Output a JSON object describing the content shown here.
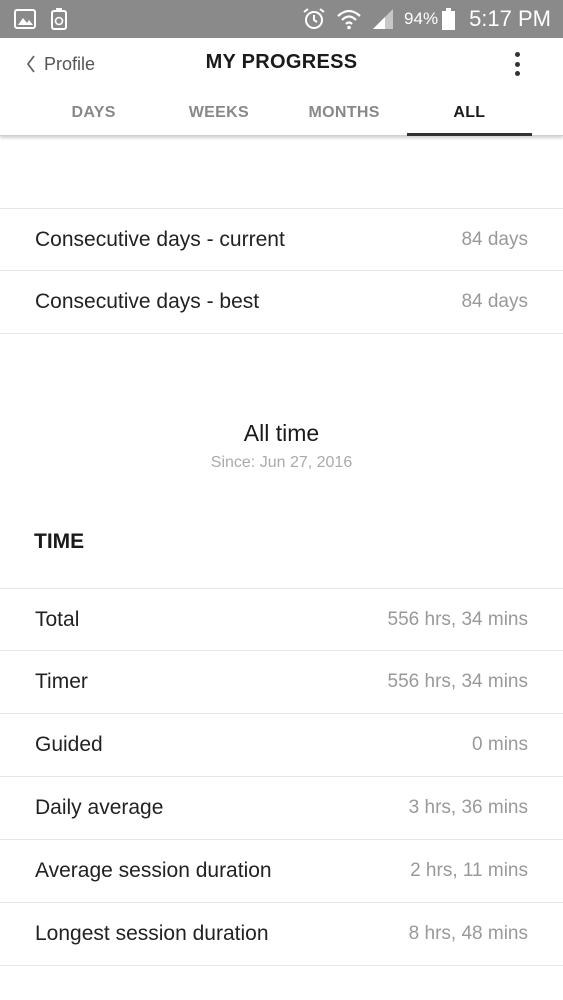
{
  "status_bar": {
    "battery_percent": "94%",
    "time": "5:17 PM",
    "icons": [
      "image-icon",
      "recycle-icon",
      "alarm-icon",
      "wifi-icon",
      "signal-icon",
      "battery-icon"
    ]
  },
  "header": {
    "back_label": "Profile",
    "title": "MY PROGRESS"
  },
  "tabs": [
    {
      "label": "DAYS",
      "active": false
    },
    {
      "label": "WEEKS",
      "active": false
    },
    {
      "label": "MONTHS",
      "active": false
    },
    {
      "label": "ALL",
      "active": true
    }
  ],
  "streaks": [
    {
      "label": "Consecutive days - current",
      "value": "84 days"
    },
    {
      "label": "Consecutive days - best",
      "value": "84 days"
    }
  ],
  "all_time": {
    "title": "All time",
    "since": "Since: Jun 27, 2016"
  },
  "time_section": {
    "heading": "TIME",
    "rows": [
      {
        "label": "Total",
        "value": "556 hrs, 34 mins"
      },
      {
        "label": "Timer",
        "value": "556 hrs, 34 mins"
      },
      {
        "label": "Guided",
        "value": "0 mins"
      },
      {
        "label": "Daily average",
        "value": "3 hrs, 36 mins"
      },
      {
        "label": "Average session duration",
        "value": "2 hrs, 11 mins"
      },
      {
        "label": "Longest session duration",
        "value": "8 hrs, 48 mins"
      }
    ]
  },
  "colors": {
    "status_bar": "#8a8a8a",
    "text_primary": "#222222",
    "text_secondary": "#999999",
    "divider": "#e6e6e6"
  }
}
